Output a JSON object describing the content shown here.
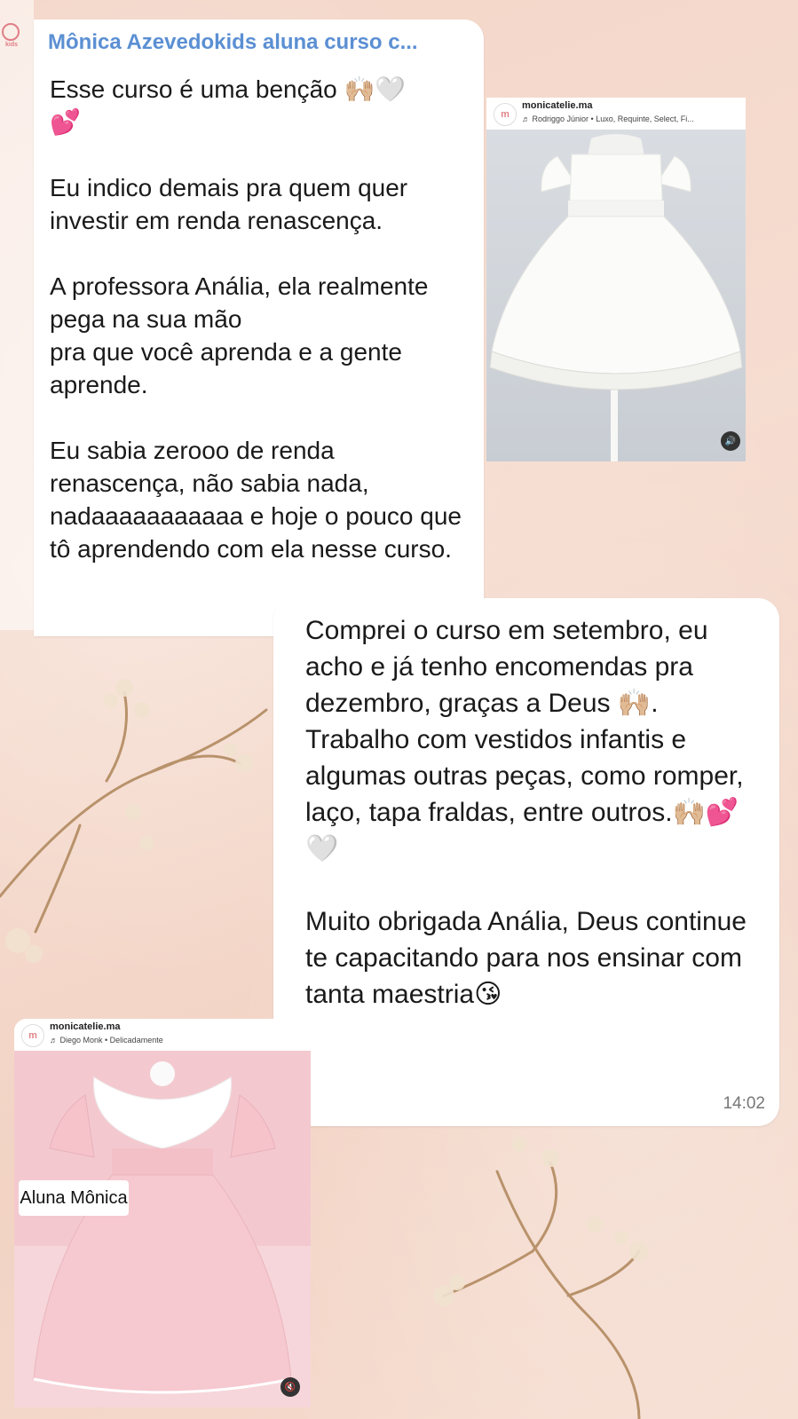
{
  "chat": {
    "sender_name": "Mônica Azevedokids aluna curso c...",
    "message1": "Esse curso é uma benção 🙌🏼🤍\n💕\n\nEu indico demais pra quem quer investir em renda renascença.\n\nA professora Anália, ela realmente pega na sua mão\npra que você aprenda e a gente aprende.\n\nEu sabia zerooo de renda renascença, não sabia nada, nadaaaaaaaaaaa e hoje o pouco que tô aprendendo com ela nesse curso.",
    "message2": "Comprei o curso em setembro, eu acho e já tenho encomendas pra dezembro, graças a Deus 🙌🏼.\nTrabalho com vestidos infantis e algumas outras peças, como romper, laço, tapa fraldas, entre outros.🙌🏼💕🤍\n\nMuito obrigada Anália, Deus continue te capacitando para nos ensinar com tanta maestria😘",
    "message2_time": "14:02"
  },
  "reels": [
    {
      "username": "monicatelie.ma",
      "music": "♬ Rodriggo Júnior • Luxo, Requinte, Select, Fi...",
      "dress_color": "#fbfbf9"
    },
    {
      "username": "monicatelie.ma",
      "music": "♬ Diego Monk • Delicadamente",
      "dress_color": "#f6c8cf"
    }
  ],
  "caption": "Aluna Mônica",
  "colors": {
    "background": "#f3d6c8",
    "sender": "#5b8fd3",
    "bubble": "#ffffff"
  }
}
